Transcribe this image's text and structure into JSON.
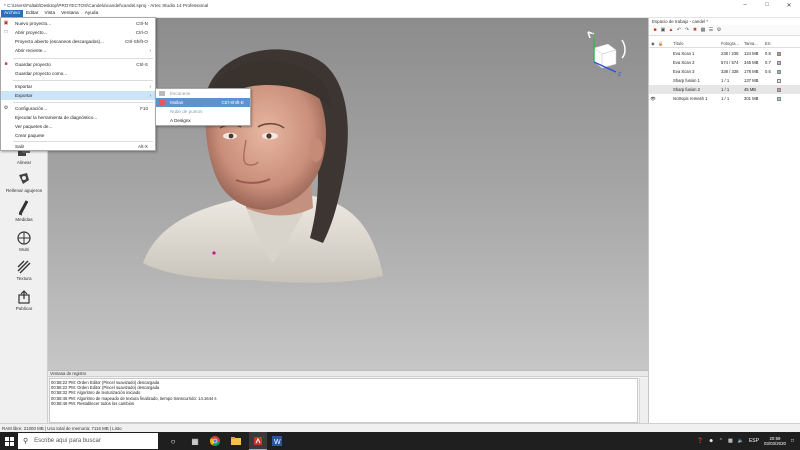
{
  "window": {
    "title": "* C:\\Users\\Faltab\\Desktop\\PROYECTOS\\Candela\\candel\\candel.sproj - Artec Studio 14 Professional"
  },
  "menubar": [
    "Archivo",
    "Editar",
    "Vista",
    "Ventana",
    "Ayuda"
  ],
  "file_menu": {
    "items": [
      {
        "icon": "new-project-icon",
        "label": "Nuevo proyecto...",
        "shortcut": "Ctrl-N"
      },
      {
        "icon": "open-folder-icon",
        "label": "Abrir proyecto...",
        "shortcut": "Ctrl-O"
      },
      {
        "icon": "",
        "label": "Proyecto abierto (escaneos descargados)...",
        "shortcut": "Ctrl-Shift-O"
      },
      {
        "icon": "",
        "label": "Abrir reciente...",
        "shortcut": "",
        "arrow": "›"
      },
      {
        "icon": "save-icon",
        "label": "Guardar proyecto",
        "shortcut": "Ctrl-S"
      },
      {
        "icon": "",
        "label": "Guardar proyecto como...",
        "shortcut": ""
      },
      {
        "icon": "",
        "label": "Importar",
        "shortcut": "",
        "arrow": "›"
      },
      {
        "icon": "",
        "label": "Exportar",
        "shortcut": "",
        "arrow": "›"
      },
      {
        "icon": "gear-icon",
        "label": "Configuración...",
        "shortcut": "F10"
      },
      {
        "icon": "",
        "label": "Ejecutar la herramienta de diagnóstico...",
        "shortcut": ""
      },
      {
        "icon": "",
        "label": "Ver paquetes de...",
        "shortcut": ""
      },
      {
        "icon": "",
        "label": "Crear paquete",
        "shortcut": ""
      },
      {
        "icon": "",
        "label": "Salir",
        "shortcut": "Alt-X"
      }
    ]
  },
  "export_submenu": {
    "items": [
      {
        "label": "Escaneos",
        "shortcut": ""
      },
      {
        "label": "Mallas",
        "shortcut": "Ctrl-Shift-E"
      },
      {
        "label": "Nube de puntos",
        "shortcut": ""
      },
      {
        "label": "A Designx",
        "shortcut": ""
      }
    ]
  },
  "left_tools": [
    {
      "icon": "align-icon",
      "label": "Alinear"
    },
    {
      "icon": "fill-holes-icon",
      "label": "Rellenar agujeros"
    },
    {
      "icon": "measure-icon",
      "label": "Medidas"
    },
    {
      "icon": "multi-icon",
      "label": "Multi"
    },
    {
      "icon": "texture-icon",
      "label": "Textura"
    },
    {
      "icon": "publish-icon",
      "label": "Publicar"
    }
  ],
  "workspace": {
    "title": "Espacio de trabajo - candel *",
    "columns": {
      "name": "Título",
      "frames": "Fotogra...",
      "size": "Tama...",
      "err": "Err."
    },
    "rows": [
      {
        "visible": "",
        "name": "Eva Scan 1",
        "frames": "238 / 238",
        "size": "124 MB",
        "err": "0.8",
        "color": "#c98f8f"
      },
      {
        "visible": "",
        "name": "Eva Scan 2",
        "frames": "574 / 574",
        "size": "345 MB",
        "err": "0.7",
        "color": "#c7aee0"
      },
      {
        "visible": "",
        "name": "Eva Scan 3",
        "frames": "338 / 338",
        "size": "178 MB",
        "err": "0.6",
        "color": "#8fc7a8"
      },
      {
        "visible": "",
        "name": "Sharp fusion 1",
        "frames": "1 / 1",
        "size": "137 MB",
        "err": "",
        "color": "#e6e6e6"
      },
      {
        "visible": "",
        "name": "Sharp fusion 2",
        "frames": "1 / 1",
        "size": "45 MB",
        "err": "",
        "color": "#e08a8a"
      },
      {
        "visible": "👁",
        "name": "Isotropic remesh 1",
        "frames": "1 / 1",
        "size": "301 MB",
        "err": "",
        "color": "#9ad6b0"
      }
    ]
  },
  "log": {
    "title": "Ventana de registro",
    "lines": [
      "00:58:22 PM: Orden Editor (Pincel suavizado) descargada",
      "00:58:22 PM: Orden Editor (Pincel suavizado) descargada",
      "00:58:32 PM: Algoritmo de texturización iniciado",
      "00:58:46 PM: Algoritmo de mapeado de textura finalizado, tiempo transcurrido: 14.1644 s",
      "00:58:46 PM: Restablecer todos los cambios"
    ]
  },
  "status": "RAM libre: 21000 MB  |  Uso total de memoria: 7116 MB  |  Listo",
  "taskbar": {
    "search_placeholder": "Escribe aquí para buscar",
    "lang": "ESP",
    "time": "20:59",
    "date": "03/03/2020"
  },
  "colors": {
    "menu_highlight": "#cce4f7",
    "submenu_highlight": "#5b93cf",
    "active_menu": "#2f6fb6"
  }
}
